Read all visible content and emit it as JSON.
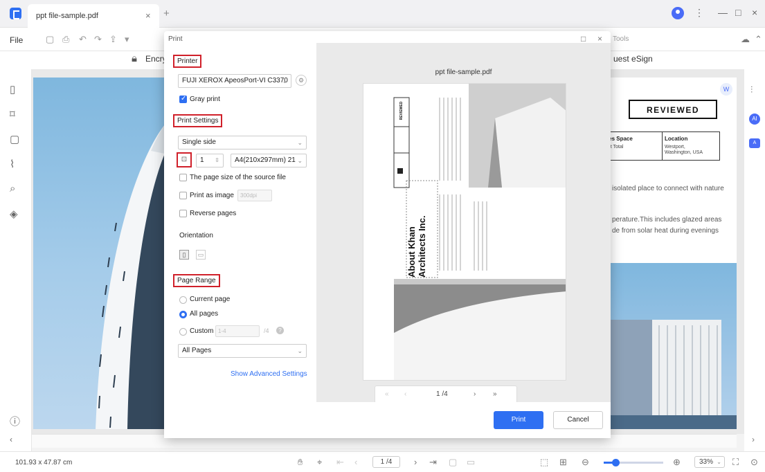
{
  "app": {
    "tab_title": "ppt file-sample.pdf",
    "tab_close": "×",
    "new_tab": "+",
    "menu_file": "File",
    "ribbon_encrypt": "Encry",
    "ribbon_esign": "uest eSign",
    "sidebar_tools": "Tools"
  },
  "window_controls": {
    "more": "⋮",
    "minimize": "—",
    "maximize": "□",
    "close": "×"
  },
  "document": {
    "reviewed_stamp": "REVIEWED",
    "info_left_title": "res Space",
    "info_left_value": "oft Total",
    "info_right_title": "Location",
    "info_right_value_1": "Westport,",
    "info_right_value_2": "Washington, USA",
    "text_1": "isolated place to connect with nature",
    "text_2": "perature.This includes glazed areas",
    "text_3": "de from solar heat during evenings"
  },
  "print_dialog": {
    "title": "Print",
    "printer_section": "Printer",
    "printer_name": "FUJI XEROX ApeosPort-VI C3370",
    "gray_print_label": "Gray print",
    "gray_print_checked": true,
    "print_settings_section": "Print Settings",
    "sides_value": "Single side",
    "copies_value": "1",
    "paper_value": "A4(210x297mm) 21",
    "source_page_size_label": "The page size of the source file",
    "print_as_image_label": "Print as image",
    "print_as_image_dpi": "300dpi",
    "reverse_pages_label": "Reverse pages",
    "orientation_label": "Orientation",
    "page_range_section": "Page Range",
    "current_page_label": "Current page",
    "all_pages_label": "All pages",
    "custom_label": "Custom",
    "custom_placeholder": "1-4",
    "custom_total": "/4",
    "subset_value": "All Pages",
    "show_advanced": "Show Advanced Settings",
    "print_button": "Print",
    "cancel_button": "Cancel",
    "preview_title": "ppt file-sample.pdf",
    "preview_page_indicator": "1 /4",
    "preview_doc_title_1": "About Khan",
    "preview_doc_title_2": "Architects Inc.",
    "preview_stamp": "REVIEWED"
  },
  "status": {
    "dimensions": "101.93 x 47.87 cm",
    "page_box": "1 /4",
    "zoom": "33%",
    "zoom_level_fraction": 0.2
  },
  "icons": {
    "logo": "app-logo-icon",
    "lock": "lock-icon",
    "page": "page-icon",
    "bookmark": "bookmark-icon",
    "comment": "comment-icon",
    "attachment": "attachment-icon",
    "search": "search-icon",
    "layers": "layers-icon",
    "help": "help-icon",
    "hand": "hand-icon",
    "select": "select-icon",
    "zoom_out": "zoom-out-icon",
    "zoom_in": "zoom-in-icon"
  },
  "colors": {
    "accent": "#2e6ff2",
    "highlight_box": "#d0202a"
  }
}
